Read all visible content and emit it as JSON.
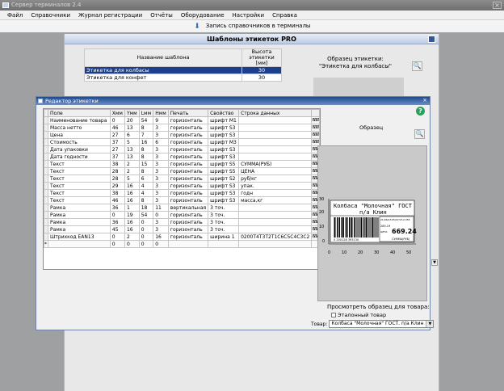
{
  "window": {
    "title": "Сервер терминалов 2.4"
  },
  "menu": [
    "Файл",
    "Справочники",
    "Журнал регистрации",
    "Отчёты",
    "Оборудование",
    "Настройки",
    "Справка"
  ],
  "toolbar": {
    "write_label": "Запись справочников в терминалы"
  },
  "templates": {
    "title": "Шаблоны этикеток PRO",
    "col_name": "Название шаблона",
    "col_height": "Высота этикетки [мм]",
    "rows": [
      {
        "name": "Этикетка для колбасы",
        "height": "30"
      },
      {
        "name": "Этикетка для конфет",
        "height": "30"
      }
    ],
    "sample_label": "Образец этикетки:",
    "sample_name": "\"Этикетка для колбасы\""
  },
  "editor": {
    "title": "Редактор этикетки",
    "columns": [
      "Поле",
      "Xмм",
      "Yмм",
      "Lмм",
      "Hмм",
      "Печать",
      "Свойство",
      "Строка данных"
    ],
    "rows": [
      [
        "Наименование товара",
        "0",
        "20",
        "54",
        "9",
        "горизонталь",
        "шрифт M1",
        ""
      ],
      [
        "Масса нетто",
        "46",
        "13",
        "8",
        "3",
        "горизонталь",
        "шрифт S3",
        ""
      ],
      [
        "Цена",
        "27",
        "6",
        "7",
        "3",
        "горизонталь",
        "шрифт S3",
        ""
      ],
      [
        "Стоимость",
        "37",
        "5",
        "16",
        "6",
        "горизонталь",
        "шрифт M3",
        ""
      ],
      [
        "Дата упаковки",
        "27",
        "13",
        "8",
        "3",
        "горизонталь",
        "шрифт S3",
        ""
      ],
      [
        "Дата годности",
        "37",
        "13",
        "8",
        "3",
        "горизонталь",
        "шрифт S3",
        ""
      ],
      [
        "Текст",
        "38",
        "2",
        "15",
        "3",
        "горизонталь",
        "шрифт S5",
        "СУММА(РУБ)"
      ],
      [
        "Текст",
        "28",
        "2",
        "8",
        "3",
        "горизонталь",
        "шрифт S5",
        "ЦЕНА"
      ],
      [
        "Текст",
        "28",
        "5",
        "6",
        "3",
        "горизонталь",
        "шрифт S2",
        "руб/кг"
      ],
      [
        "Текст",
        "29",
        "16",
        "4",
        "3",
        "горизонталь",
        "шрифт S3",
        "упак."
      ],
      [
        "Текст",
        "38",
        "16",
        "4",
        "3",
        "горизонталь",
        "шрифт S3",
        "годн"
      ],
      [
        "Текст",
        "46",
        "16",
        "8",
        "3",
        "горизонталь",
        "шрифт S3",
        "масса,кг"
      ],
      [
        "Рамка",
        "36",
        "1",
        "18",
        "11",
        "вертикальная",
        "3 точ.",
        ""
      ],
      [
        "Рамка",
        "0",
        "19",
        "54",
        "0",
        "горизонталь",
        "3 точ.",
        ""
      ],
      [
        "Рамка",
        "36",
        "16",
        "0",
        "3",
        "горизонталь",
        "3 точ.",
        ""
      ],
      [
        "Рамка",
        "45",
        "16",
        "0",
        "3",
        "горизонталь",
        "3 точ.",
        ""
      ],
      [
        "Штрихкод EAN13",
        "0",
        "2",
        "0",
        "16",
        "горизонталь",
        "ширина 1",
        "0200T4T3T2T1C6C5C4C3C2"
      ],
      [
        "",
        "0",
        "0",
        "0",
        "0",
        "",
        "",
        ""
      ]
    ],
    "new_row_marker": "*",
    "sample_label": "Образец",
    "view_label": "Просмотреть образец для товара:",
    "etalon_label": "Эталонный товар",
    "goods_label": "Товар:",
    "goods_value": "Колбаса \"Молочная\" ГОСТ. п/а Клин"
  },
  "label_preview": {
    "name_line1": "Колбаса \"Молочная\" ГОСТ",
    "name_line2": "п/а Клин",
    "barcode_digits": "0 200128 393130",
    "price_caption": "ЦЕНА",
    "price": "285.19",
    "sum_caption": "СУММА(РУБ)",
    "sum": "669.24",
    "packed": "21/06/15",
    "best_before": "05/07/15",
    "mass": "2.355",
    "ruler_left": [
      "30",
      "20",
      "10",
      "0"
    ],
    "ruler_bottom": [
      "0",
      "10",
      "20",
      "30",
      "40",
      "50"
    ]
  }
}
